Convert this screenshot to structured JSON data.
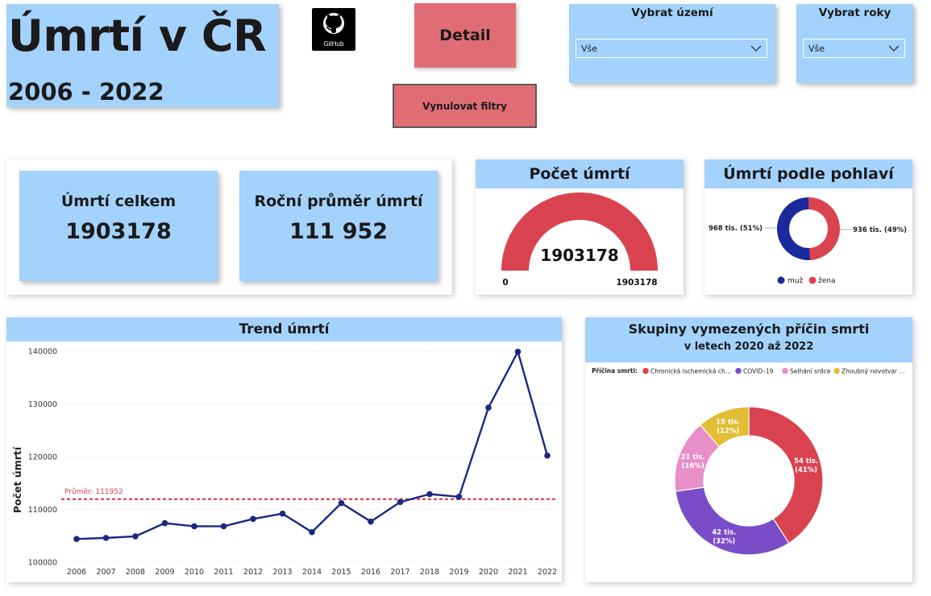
{
  "header": {
    "title": "Úmrtí v ČR",
    "years": "2006 - 2022",
    "github_label": "GitHub",
    "detail_button": "Detail",
    "reset_button": "Vynulovat filtry"
  },
  "filters": {
    "territory": {
      "label": "Vybrat území",
      "value": "Vše"
    },
    "years": {
      "label": "Vybrat roky",
      "value": "Vše"
    }
  },
  "kpis": {
    "total": {
      "label": "Úmrtí celkem",
      "value": "1903178"
    },
    "average": {
      "label": "Roční průměr úmrtí",
      "value": "111 952"
    }
  },
  "gauge": {
    "title": "Počet úmrtí",
    "value": "1903178",
    "min_label": "0",
    "max_label": "1903178",
    "fill_fraction": 1.0,
    "color": "#d9434f"
  },
  "gender": {
    "title": "Úmrtí podle pohlaví",
    "male_label": "968 tis. (51%)",
    "female_label": "936 tis. (49%)",
    "legend_male": "muž",
    "legend_female": "žena",
    "colors": {
      "male": "#1a2a9c",
      "female": "#d9434f"
    }
  },
  "trend": {
    "title": "Trend úmrtí",
    "ylabel": "Počet úmrtí",
    "avg_label": "Průměr: 111952"
  },
  "causes": {
    "title": "Skupiny vymezených příčin smrti",
    "subtitle": "v letech 2020 až 2022",
    "legend_title": "Příčina smrti:",
    "legend": [
      "Chronická ischemická ch...",
      "COVID–19",
      "Selhání srdce",
      "Zhoubný novotvar ..."
    ],
    "slice_labels": [
      {
        "value": "54 tis.",
        "pct": "(41%)"
      },
      {
        "value": "42 tis.",
        "pct": "(32%)"
      },
      {
        "value": "21 tis.",
        "pct": "(16%)"
      },
      {
        "value": "15 tis.",
        "pct": "(12%)"
      }
    ]
  },
  "chart_data": [
    {
      "type": "line",
      "title": "Trend úmrtí",
      "xlabel": "",
      "ylabel": "Počet úmrtí",
      "categories": [
        "2006",
        "2007",
        "2008",
        "2009",
        "2010",
        "2011",
        "2012",
        "2013",
        "2014",
        "2015",
        "2016",
        "2017",
        "2018",
        "2019",
        "2020",
        "2021",
        "2022"
      ],
      "values": [
        104400,
        104600,
        104900,
        107400,
        106800,
        106800,
        108200,
        109200,
        105700,
        111200,
        107700,
        111400,
        112900,
        112400,
        129300,
        139900,
        120200
      ],
      "average": 111952,
      "yticks": [
        "100000",
        "110000",
        "120000",
        "130000",
        "140000"
      ],
      "ylim": [
        100000,
        140000
      ],
      "color": "#1a2a80",
      "average_color": "#d9434f",
      "grid": true
    },
    {
      "type": "pie",
      "title": "Úmrtí podle pohlaví",
      "categories": [
        "muž",
        "žena"
      ],
      "values": [
        968,
        936
      ],
      "colors": [
        "#1a2a9c",
        "#d9434f"
      ],
      "legend": "bottom"
    },
    {
      "type": "pie",
      "title": "Skupiny vymezených příčin smrti",
      "categories": [
        "Chronická ischemická ch...",
        "COVID–19",
        "Selhání srdce",
        "Zhoubný novotvar ..."
      ],
      "values": [
        54,
        42,
        21,
        15
      ],
      "colors": [
        "#d9434f",
        "#7a4dc8",
        "#e88ec9",
        "#e3bd34"
      ],
      "legend": "top"
    }
  ]
}
